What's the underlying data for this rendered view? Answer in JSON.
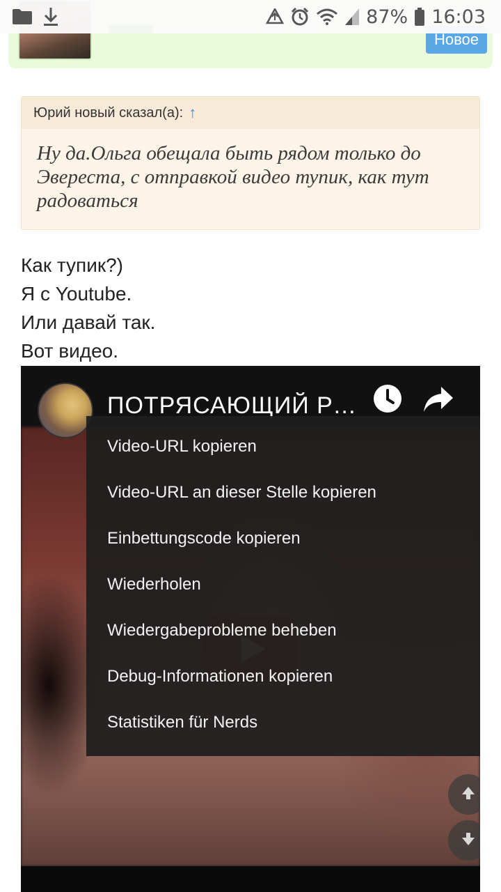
{
  "status_bar": {
    "battery": "87%",
    "time": "16:03",
    "icons": [
      "folder-icon",
      "download-icon",
      "recycle-icon",
      "alarm-icon",
      "wifi-icon",
      "signal-icon",
      "battery-icon"
    ]
  },
  "top_post": {
    "badge": "Новое"
  },
  "quote": {
    "author": "Юрий новый сказал(а):",
    "arrow": "↑",
    "text": "Ну да.Ольга обещала быть рядом только до Эвереста, с отправкой видео тупик, как тут радоваться"
  },
  "message": {
    "lines": [
      "Как тупик?)",
      "Я с Youtube.",
      "Или давай так.",
      "Вот видео."
    ]
  },
  "video": {
    "title": "ПОТРЯСАЮЩИЙ РО...",
    "context_menu": [
      "Video-URL kopieren",
      "Video-URL an dieser Stelle kopieren",
      "Einbettungscode kopieren",
      "Wiederholen",
      "Wiedergabeprobleme beheben",
      "Debug-Informationen kopieren",
      "Statistiken für Nerds"
    ]
  },
  "colors": {
    "accent_blue": "#5aa7e6",
    "quote_bg": "#fdf4e8",
    "post_bg": "#eafbdc"
  }
}
